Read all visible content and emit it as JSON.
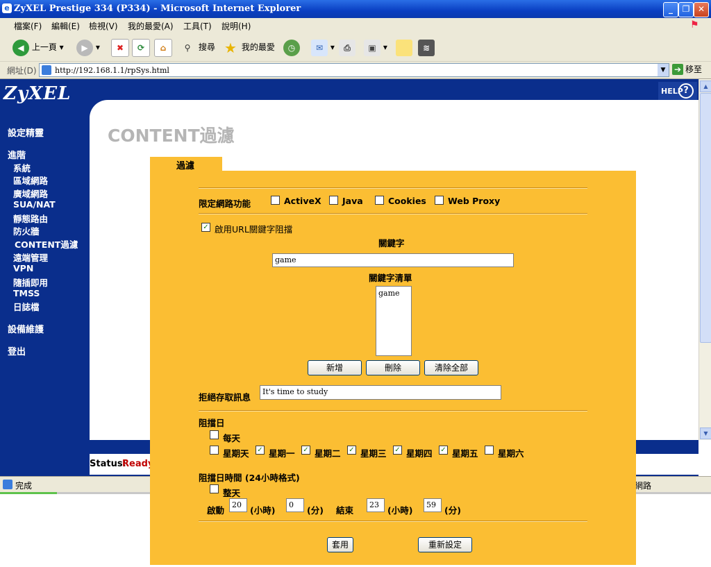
{
  "window": {
    "title": "ZyXEL Prestige 334 (P334) - Microsoft Internet Explorer"
  },
  "menu": [
    "檔案(F)",
    "編輯(E)",
    "檢視(V)",
    "我的最愛(A)",
    "工具(T)",
    "說明(H)"
  ],
  "toolbar": {
    "back": "上一頁",
    "search": "搜尋",
    "favorites": "我的最愛"
  },
  "address": {
    "label": "網址(D)",
    "url": "http://192.168.1.1/rpSys.html",
    "go": "移至"
  },
  "page": {
    "logo": "ZyXEL",
    "help": "HELP",
    "title_en": "CONTENT",
    "title_zh": "過濾",
    "status_label": "Status:",
    "status_value": "Ready"
  },
  "nav": {
    "wizard": "設定精靈",
    "advanced": "進階",
    "items": [
      "系統",
      "區域網路",
      "廣域網路",
      "SUA/NAT",
      "靜態路由",
      "防火牆",
      "CONTENT過濾",
      "遠端管理",
      "VPN",
      "隨插即用",
      "TMSS",
      "日誌檔"
    ],
    "maintenance": "設備維護",
    "logout": "登出"
  },
  "filter": {
    "tab": "過濾",
    "restrict_label": "限定網路功能",
    "restrict_options": [
      {
        "label": "ActiveX",
        "checked": false
      },
      {
        "label": "Java",
        "checked": false
      },
      {
        "label": "Cookies",
        "checked": false
      },
      {
        "label": "Web Proxy",
        "checked": false
      }
    ],
    "enable_url_label": "啟用URL關鍵字阻擋",
    "enable_url_checked": true,
    "keyword_label": "關鍵字",
    "keyword_value": "game",
    "keyword_list_label": "關鍵字清單",
    "keyword_list": [
      "game"
    ],
    "add_button": "新增",
    "delete_button": "刪除",
    "clear_button": "清除全部",
    "deny_label": "拒絕存取訊息",
    "deny_value": "It's time to study",
    "block_day_label": "阻擋日",
    "everyday_label": "每天",
    "everyday_checked": false,
    "days": [
      {
        "label": "星期天",
        "checked": false
      },
      {
        "label": "星期一",
        "checked": true
      },
      {
        "label": "星期二",
        "checked": true
      },
      {
        "label": "星期三",
        "checked": true
      },
      {
        "label": "星期四",
        "checked": true
      },
      {
        "label": "星期五",
        "checked": true
      },
      {
        "label": "星期六",
        "checked": false
      }
    ],
    "block_time_label": "阻擋日時間 (24小時格式)",
    "allday_label": "整天",
    "allday_checked": false,
    "start_label": "啟動",
    "start_hour": "20",
    "start_min": "0",
    "end_label": "結束",
    "end_hour": "23",
    "end_min": "59",
    "hour_unit": "(小時)",
    "min_unit": "(分)",
    "apply_button": "套用",
    "reset_button": "重新設定"
  },
  "statusbar": {
    "done": "完成",
    "zone": "網路"
  }
}
